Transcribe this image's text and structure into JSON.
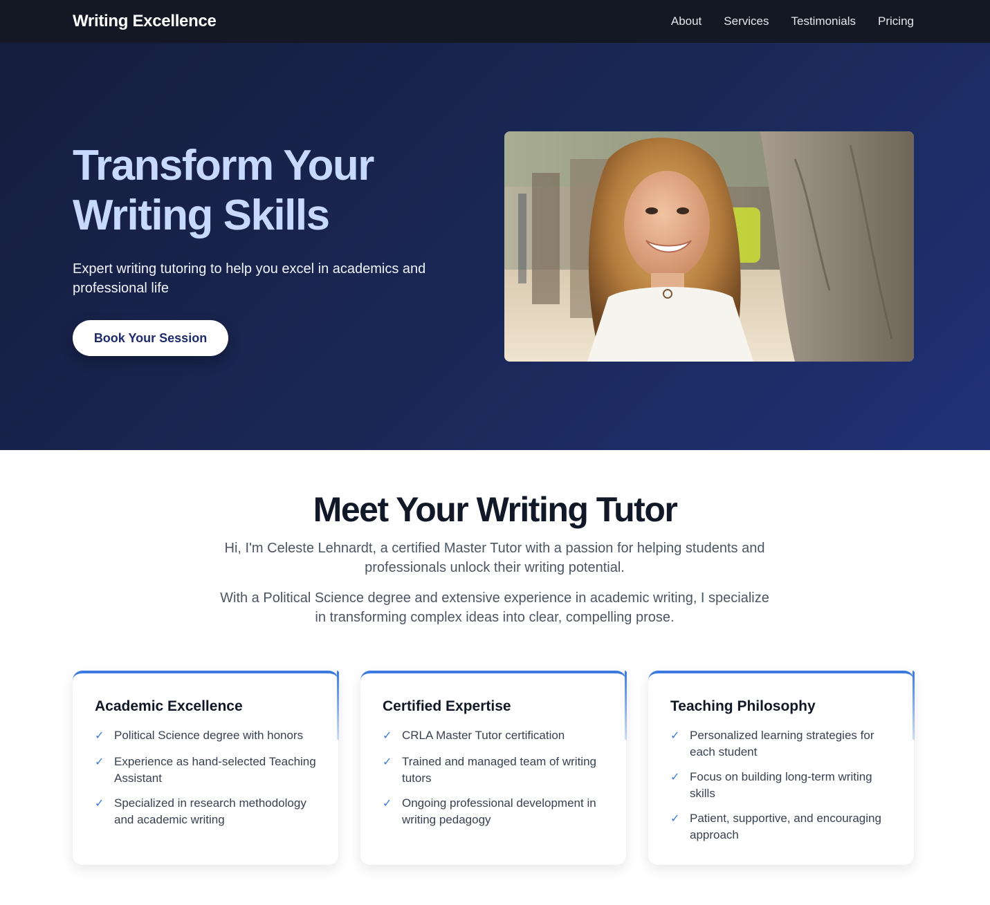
{
  "nav": {
    "brand": "Writing Excellence",
    "links": [
      "About",
      "Services",
      "Testimonials",
      "Pricing"
    ]
  },
  "hero": {
    "title": "Transform Your Writing Skills",
    "subtitle": "Expert writing tutoring to help you excel in academics and professional life",
    "cta": "Book Your Session",
    "photo_alt": "Smiling tutor portrait"
  },
  "about": {
    "title": "Meet Your Writing Tutor",
    "intro": "Hi, I'm Celeste Lehnardt, a certified Master Tutor with a passion for helping students and professionals unlock their writing potential.",
    "detail": "With a Political Science degree and extensive experience in academic writing, I specialize in transforming complex ideas into clear, compelling prose."
  },
  "cards": [
    {
      "title": "Academic Excellence",
      "items": [
        "Political Science degree with honors",
        "Experience as hand-selected Teaching Assistant",
        "Specialized in research methodology and academic writing"
      ]
    },
    {
      "title": "Certified Expertise",
      "items": [
        "CRLA Master Tutor certification",
        "Trained and managed team of writing tutors",
        "Ongoing professional development in writing pedagogy"
      ]
    },
    {
      "title": "Teaching Philosophy",
      "items": [
        "Personalized learning strategies for each student",
        "Focus on building long-term writing skills",
        "Patient, supportive, and encouraging approach"
      ]
    }
  ],
  "colors": {
    "nav_bg": "#141824",
    "hero_start": "#151d3d",
    "hero_end": "#203177",
    "hero_title": "#c7d9ff",
    "accent": "#3b7be0"
  },
  "icons": {
    "list_bullet": "check-icon"
  }
}
